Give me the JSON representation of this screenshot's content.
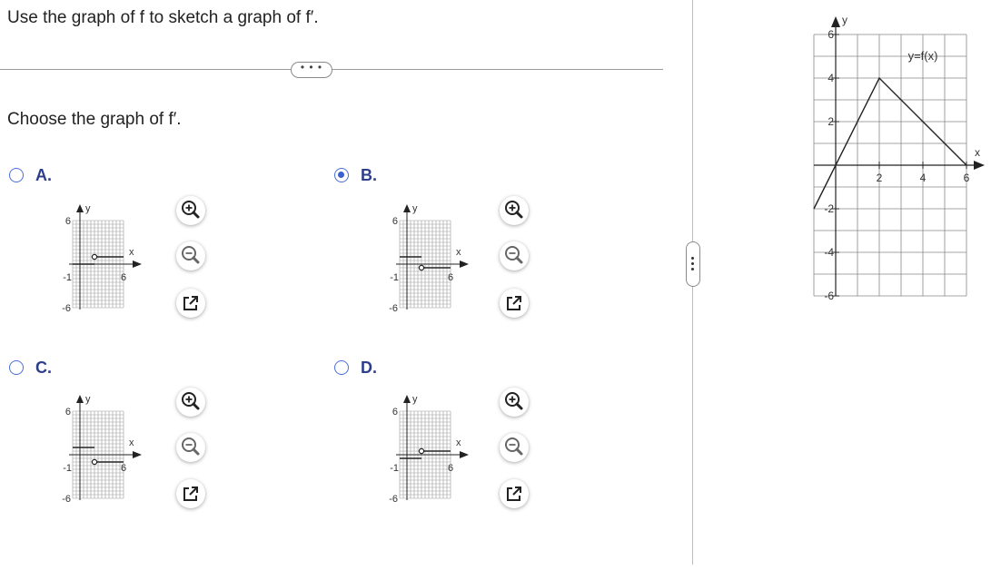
{
  "question": "Use the graph of f to sketch a graph of f′.",
  "more_button": "• • •",
  "prompt": "Choose the graph of f′.",
  "options": [
    {
      "label": "A.",
      "selected": false
    },
    {
      "label": "B.",
      "selected": true
    },
    {
      "label": "C.",
      "selected": false
    },
    {
      "label": "D.",
      "selected": false
    }
  ],
  "small_graph": {
    "y_label": "y",
    "x_label": "x",
    "y_top": "6",
    "y_bottom": "-6",
    "x_left": "-1",
    "x_right": "6"
  },
  "tools": {
    "zoom_in": "zoom-in-icon",
    "zoom_out": "zoom-out-icon",
    "open_new": "open-in-new-window-icon"
  },
  "main_graph": {
    "y_label": "y",
    "x_label": "x",
    "function_label": "y=f(x)",
    "y_ticks": [
      "6",
      "4",
      "2",
      "-2",
      "-4",
      "-6"
    ],
    "x_ticks": [
      "2",
      "4",
      "6"
    ],
    "f_points": [
      [
        -1,
        -2
      ],
      [
        2,
        4
      ],
      [
        6,
        0
      ]
    ]
  },
  "colors": {
    "accent": "#3a5fcf",
    "label": "#2d3e8c",
    "grid": "#888888"
  }
}
